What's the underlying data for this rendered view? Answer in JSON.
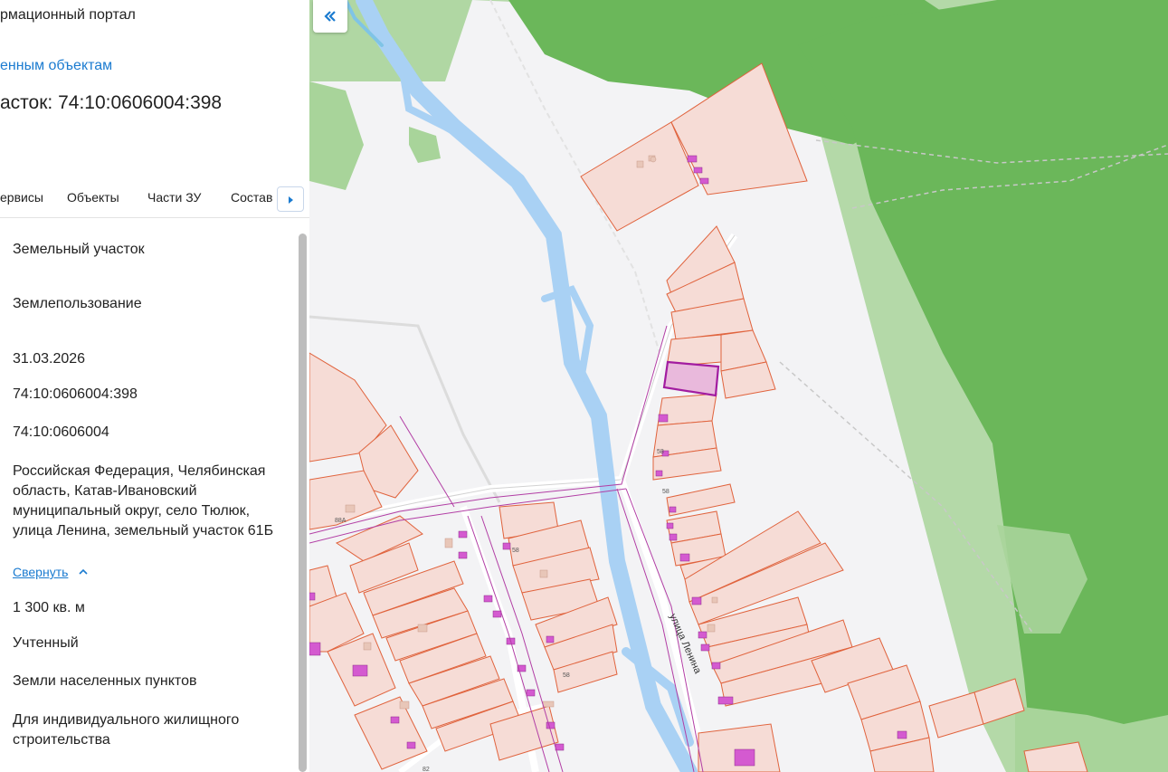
{
  "header": {
    "portal_title": "рмационный портал",
    "breadcrumb": "енным объектам",
    "parcel_title": "асток: 74:10:0606004:398"
  },
  "tabs": [
    "ервисы",
    "Объекты",
    "Части ЗУ",
    "Состав"
  ],
  "info": {
    "object_type": "Земельный участок",
    "subtype": "Землепользование",
    "date": "31.03.2026",
    "cadastral_number": "74:10:0606004:398",
    "quarter": "74:10:0606004",
    "address": "Российская Федерация, Челябинская область, Катав-Ивановский муниципальный округ, село Тюлюк, улица Ленина, земельный участок 61Б",
    "collapse_link": "Свернуть",
    "area": "1 300 кв. м",
    "status": "Учтенный",
    "category": "Земли населенных пунктов",
    "permitted_use": "Для индивидуального жилищного строительства"
  },
  "map": {
    "street_label": "улица Ленина",
    "house_numbers": [
      "58",
      "58",
      "88А",
      "58",
      "82",
      "58"
    ],
    "colors": {
      "forest": "#6bb75a",
      "forest_light": "#a8d49a",
      "river": "#a9d1f4",
      "parcel_fill": "#f6dcd6",
      "parcel_stroke": "#e0633d",
      "building": "#d45ad0",
      "selected_fill": "#e9b9dc",
      "selected_stroke": "#a21ca0",
      "link": "#1b7bd0"
    }
  },
  "icons": {
    "collapse_panel": "double-chevron-left-icon",
    "tab_scroll": "caret-right-icon",
    "collapse": "chevron-up-icon"
  }
}
